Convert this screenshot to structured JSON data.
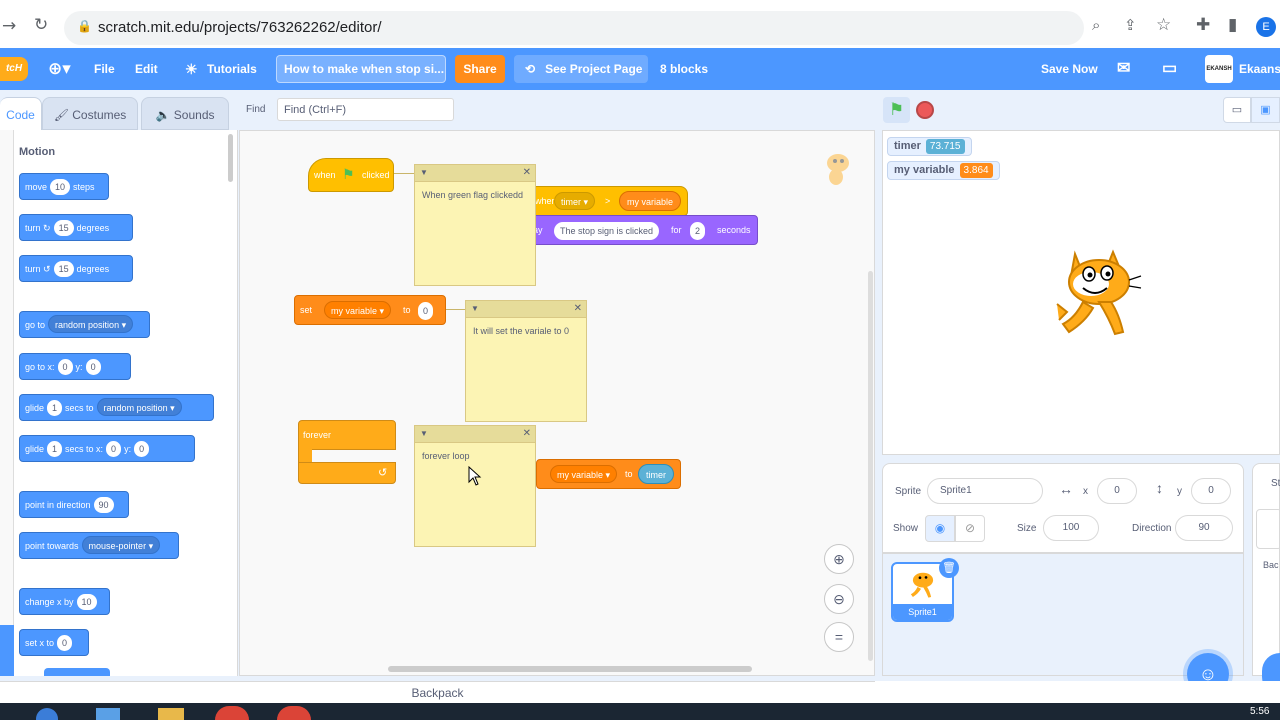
{
  "browser": {
    "url": "scratch.mit.edu/projects/763262262/editor/",
    "profile_initial": "E"
  },
  "menu": {
    "logo": "tcH",
    "file": "File",
    "edit": "Edit",
    "tutorials": "Tutorials",
    "project_title": "How to make when stop si...",
    "share": "Share",
    "see_project_page": "See Project Page",
    "blocks_count": "8 blocks",
    "save_now": "Save Now",
    "username": "Ekaansh",
    "avatar_text": "EKANSH"
  },
  "tabs": {
    "code": "Code",
    "costumes": "Costumes",
    "sounds": "Sounds",
    "find_label": "Find",
    "find_placeholder": "Find (Ctrl+F)"
  },
  "palette": {
    "category": "Motion",
    "move": {
      "a": "move",
      "v": "10",
      "b": "steps"
    },
    "turn_right": {
      "a": "turn",
      "v": "15",
      "b": "degrees"
    },
    "turn_left": {
      "a": "turn",
      "v": "15",
      "b": "degrees"
    },
    "go_to": {
      "a": "go to",
      "dd": "random position"
    },
    "go_to_xy": {
      "a": "go to x:",
      "x": "0",
      "b": "y:",
      "y": "0"
    },
    "glide_to": {
      "a": "glide",
      "v": "1",
      "b": "secs to",
      "dd": "random position"
    },
    "glide_xy": {
      "a": "glide",
      "v": "1",
      "b": "secs to x:",
      "x": "0",
      "c": "y:",
      "y": "0"
    },
    "point_direction": {
      "a": "point in direction",
      "v": "90"
    },
    "point_towards": {
      "a": "point towards",
      "dd": "mouse-pointer"
    },
    "change_x": {
      "a": "change x by",
      "v": "10"
    },
    "set_x": {
      "a": "set x to",
      "v": "0"
    }
  },
  "scripts": {
    "hat1": {
      "a": "when",
      "b": "clicked"
    },
    "note1": "When green flag clickedd",
    "hat2": {
      "a": "when",
      "dd": "timer",
      "op": ">",
      "var": "my variable"
    },
    "say": {
      "a": "ay",
      "msg": "The stop sign is clicked",
      "b": "for",
      "secs": "2",
      "c": "seconds"
    },
    "setvar": {
      "a": "set",
      "dd": "my variable",
      "b": "to",
      "v": "0"
    },
    "note2": "It will set the variale to 0",
    "forever": "forever",
    "note3": "forever loop",
    "setvar2": {
      "dd": "my variable",
      "b": "to",
      "r": "timer"
    }
  },
  "stage": {
    "monitor_timer": {
      "label": "timer",
      "value": "73.715"
    },
    "monitor_var": {
      "label": "my variable",
      "value": "3.864"
    }
  },
  "sprite_info": {
    "sprite_label": "Sprite",
    "sprite_name": "Sprite1",
    "x_label": "x",
    "x": "0",
    "y_label": "y",
    "y": "0",
    "show_label": "Show",
    "size_label": "Size",
    "size": "100",
    "direction_label": "Direction",
    "direction": "90",
    "thumb_name": "Sprite1"
  },
  "stage_panel": {
    "backdrops_partial": "Bac",
    "stage_partial": "St"
  },
  "bottom": {
    "backpack": "Backpack"
  },
  "taskbar": {
    "time": "5:56"
  },
  "colors": {
    "motion": "#4c97ff",
    "events": "#ffbf00",
    "looks": "#9966ff",
    "variables": "#ff8c1a",
    "sensing": "#5cb1d6",
    "control": "#ffab19"
  }
}
